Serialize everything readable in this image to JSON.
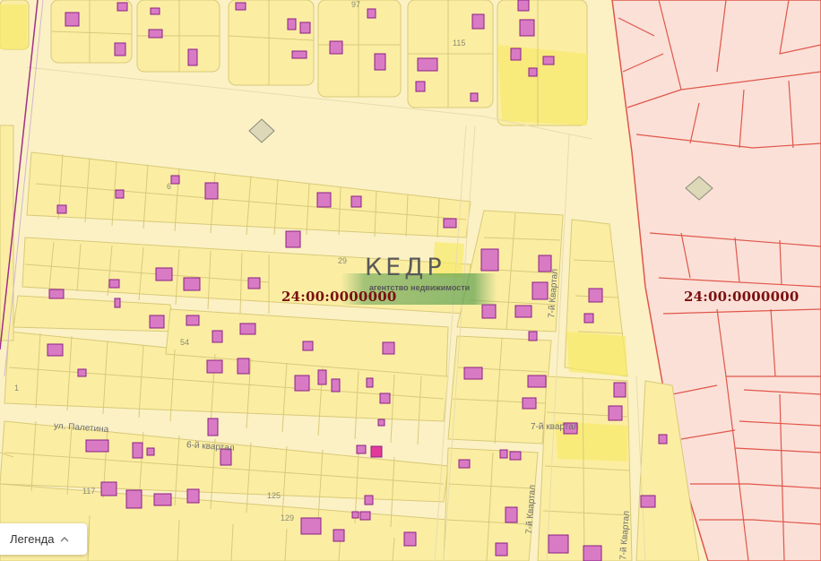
{
  "map": {
    "cadastral_label_center": "24:00:0000000",
    "cadastral_label_right": "24:00:0000000",
    "street_name": "ул. Палетина",
    "quarter_label": "6-й квартал",
    "quarter_label_7": "7-й квартал",
    "quarter_vertical_1": "7-й Квартал",
    "quarter_vertical_2": "7-й Квартал",
    "quarter_vertical_3": "7-й Квартал",
    "lot_numbers": [
      "97",
      "115",
      "6",
      "29",
      "54",
      "1",
      "117",
      "125",
      "129"
    ],
    "colors": {
      "background": "#fbf1c4",
      "parcel_fill": "#fbeea3",
      "parcel_stroke": "#d9c979",
      "building_fill": "#d97bc4",
      "building_stroke": "#8b1f86",
      "zone_fill": "#fbe0d8",
      "zone_stroke": "#e0574a",
      "highlight_fill": "#f7ea6a"
    }
  },
  "logo": {
    "word": "КЕДР",
    "tagline": "агентство недвижимости"
  },
  "legend": {
    "label": "Легенда",
    "icon": "chevron-up-icon"
  }
}
